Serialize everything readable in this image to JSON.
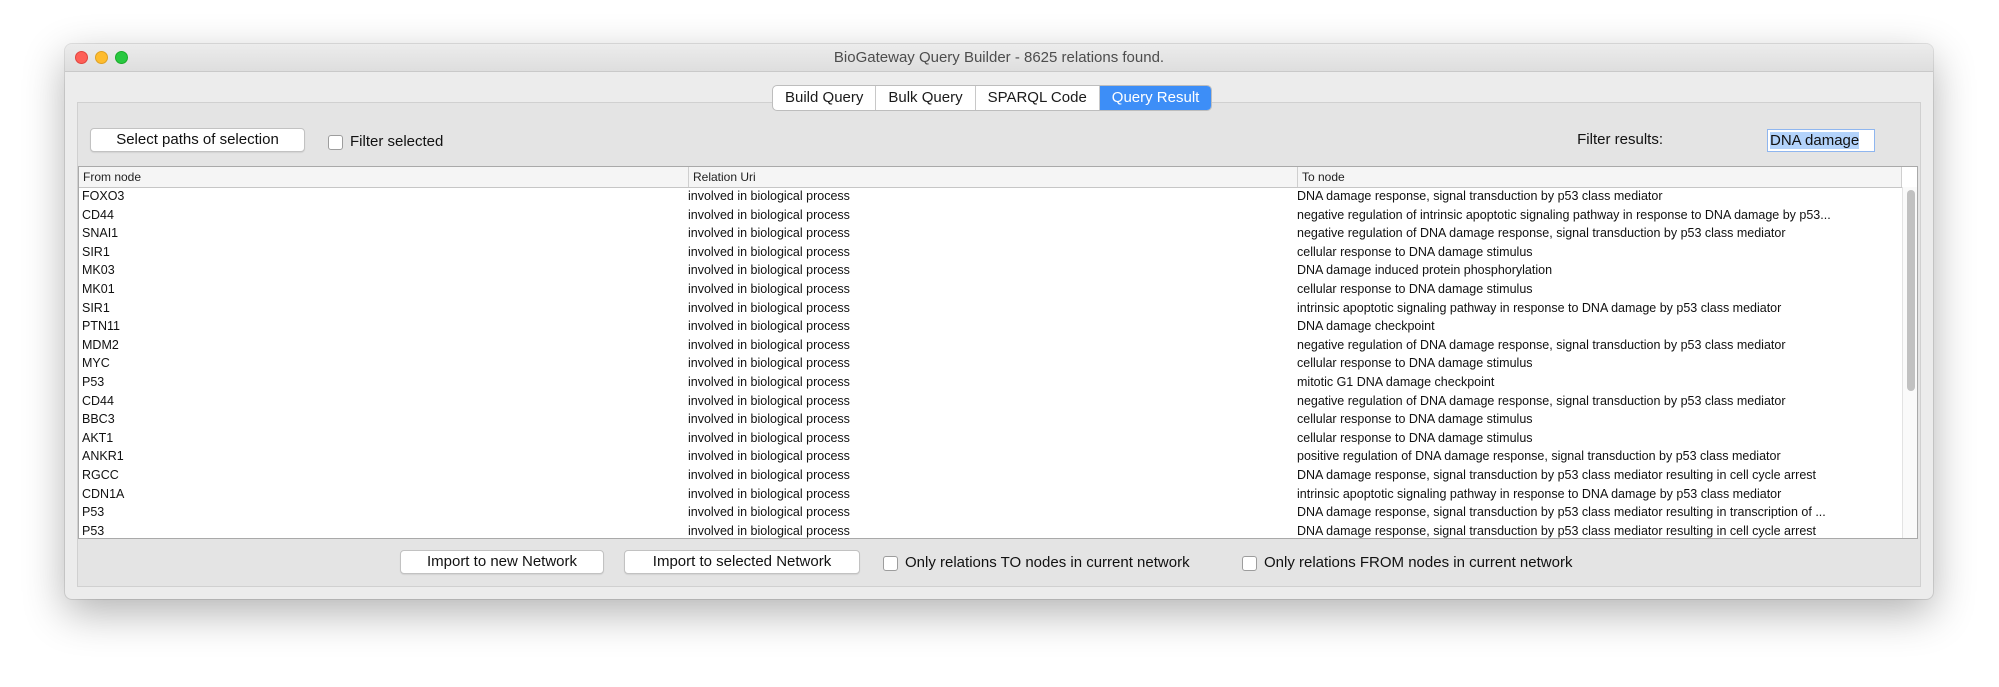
{
  "window": {
    "title": "BioGateway Query Builder - 8625 relations found."
  },
  "tabs": [
    {
      "label": "Build Query",
      "active": false
    },
    {
      "label": "Bulk Query",
      "active": false
    },
    {
      "label": "SPARQL Code",
      "active": false
    },
    {
      "label": "Query Result",
      "active": true
    }
  ],
  "toolbar": {
    "select_paths_label": "Select paths of selection",
    "filter_selected_label": "Filter selected",
    "filter_selected_checked": false,
    "filter_results_label": "Filter results:",
    "filter_results_value": "DNA damage"
  },
  "table": {
    "columns": [
      "From node",
      "Relation Uri",
      "To node"
    ],
    "rows": [
      [
        "FOXO3",
        "involved in biological process",
        "DNA damage response, signal transduction by p53 class mediator"
      ],
      [
        "CD44",
        "involved in biological process",
        "negative regulation of intrinsic apoptotic signaling pathway in response to DNA damage by p53..."
      ],
      [
        "SNAI1",
        "involved in biological process",
        "negative regulation of DNA damage response, signal transduction by p53 class mediator"
      ],
      [
        "SIR1",
        "involved in biological process",
        "cellular response to DNA damage stimulus"
      ],
      [
        "MK03",
        "involved in biological process",
        "DNA damage induced protein phosphorylation"
      ],
      [
        "MK01",
        "involved in biological process",
        "cellular response to DNA damage stimulus"
      ],
      [
        "SIR1",
        "involved in biological process",
        "intrinsic apoptotic signaling pathway in response to DNA damage by p53 class mediator"
      ],
      [
        "PTN11",
        "involved in biological process",
        "DNA damage checkpoint"
      ],
      [
        "MDM2",
        "involved in biological process",
        "negative regulation of DNA damage response, signal transduction by p53 class mediator"
      ],
      [
        "MYC",
        "involved in biological process",
        "cellular response to DNA damage stimulus"
      ],
      [
        "P53",
        "involved in biological process",
        "mitotic G1 DNA damage checkpoint"
      ],
      [
        "CD44",
        "involved in biological process",
        "negative regulation of DNA damage response, signal transduction by p53 class mediator"
      ],
      [
        "BBC3",
        "involved in biological process",
        "cellular response to DNA damage stimulus"
      ],
      [
        "AKT1",
        "involved in biological process",
        "cellular response to DNA damage stimulus"
      ],
      [
        "ANKR1",
        "involved in biological process",
        "positive regulation of DNA damage response, signal transduction by p53 class mediator"
      ],
      [
        "RGCC",
        "involved in biological process",
        "DNA damage response, signal transduction by p53 class mediator resulting in cell cycle arrest"
      ],
      [
        "CDN1A",
        "involved in biological process",
        "intrinsic apoptotic signaling pathway in response to DNA damage by p53 class mediator"
      ],
      [
        "P53",
        "involved in biological process",
        "DNA damage response, signal transduction by p53 class mediator resulting in transcription of ..."
      ],
      [
        "P53",
        "involved in biological process",
        "DNA damage response, signal transduction by p53 class mediator resulting in cell cycle arrest"
      ]
    ]
  },
  "footer": {
    "import_new_label": "Import to new Network",
    "import_selected_label": "Import to selected Network",
    "only_to_label": "Only relations TO nodes in current network",
    "only_to_checked": false,
    "only_from_label": "Only relations FROM nodes in current network",
    "only_from_checked": false
  },
  "colors": {
    "active_tab": "#3d8ef7",
    "close_light": "#fe5f57",
    "minimize_light": "#febc2e",
    "zoom_light": "#28c840",
    "selection_highlight": "#b3d3fb"
  }
}
